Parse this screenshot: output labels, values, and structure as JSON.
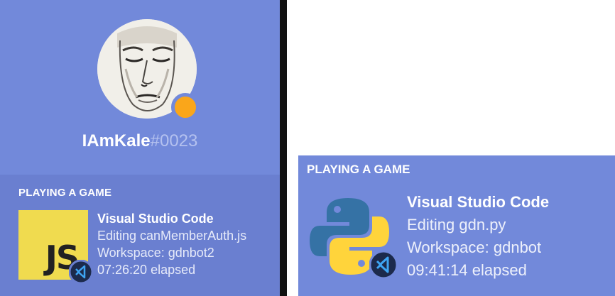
{
  "left_card": {
    "username": "IAmKale",
    "discriminator": "#0023",
    "activity_heading": "PLAYING A GAME",
    "game_icon_text": "JS",
    "game_title": "Visual Studio Code",
    "details": "Editing canMemberAuth.js",
    "workspace": "Workspace: gdnbot2",
    "elapsed": "07:26:20 elapsed",
    "status_color": "#faa61a"
  },
  "right_card": {
    "activity_heading": "PLAYING A GAME",
    "game_title": "Visual Studio Code",
    "details": "Editing gdn.py",
    "workspace": "Workspace: gdnbot",
    "elapsed": "09:41:14 elapsed"
  },
  "colors": {
    "blurple": "#7289da",
    "panel_dark": "#6a7fd0",
    "js_yellow": "#f0db4f",
    "python_blue": "#3572a5",
    "python_yellow": "#ffd43b"
  }
}
